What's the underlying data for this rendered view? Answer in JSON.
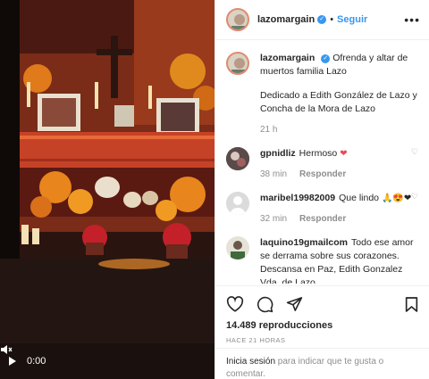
{
  "video": {
    "time": "0:00",
    "play_icon": "play-icon",
    "mute_icon": "mute-icon"
  },
  "header": {
    "username": "lazomargain",
    "separator": "•",
    "follow_label": "Seguir",
    "more_label": "•••"
  },
  "caption": {
    "username": "lazomargain",
    "line1": "Ofrenda y altar de muertos familia Lazo",
    "line2": "Dedicado a Edith González de Lazo y Concha de la Mora de Lazo",
    "time": "21 h"
  },
  "comments": [
    {
      "username": "gpnidliz",
      "text": "Hermoso",
      "emoji": "❤",
      "time": "38 min",
      "reply": "Responder"
    },
    {
      "username": "maribel19982009",
      "text": "Que lindo",
      "emoji": "🙏😍❤",
      "time": "32 min",
      "reply": "Responder"
    },
    {
      "username": "laquino19gmailcom",
      "text": "Todo ese amor se derrama sobre sus corazones. Descansa en Paz, Edith Gonzalez Vda. de Lazo."
    }
  ],
  "stats": {
    "views": "14.489 reproducciones",
    "ago": "HACE 21 HORAS"
  },
  "login": {
    "link": "Inicia sesión",
    "rest": " para indicar que te gusta o comentar."
  },
  "colors": {
    "accent": "#3897f0",
    "secondary_text": "#8e8e8e",
    "heart": "#ed4956"
  }
}
